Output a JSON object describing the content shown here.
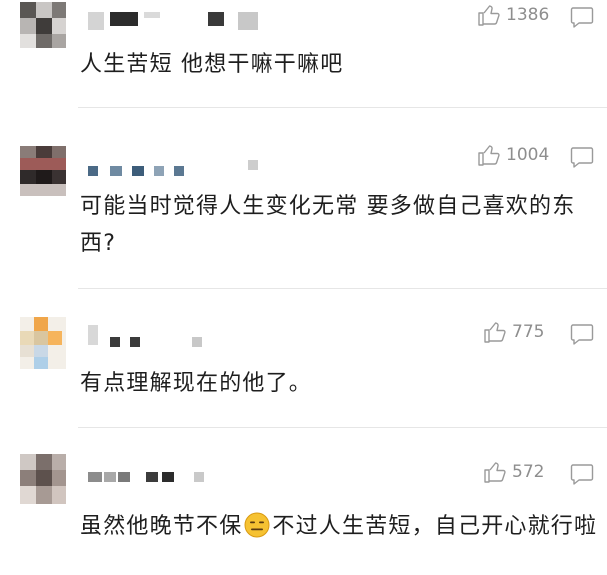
{
  "comments": [
    {
      "likes": "1386",
      "text": "人生苦短 他想干嘛干嘛吧"
    },
    {
      "likes": "1004",
      "text": "可能当时觉得人生变化无常 要多做自己喜欢的东西?"
    },
    {
      "likes": "775",
      "text": "有点理解现在的他了。"
    },
    {
      "likes": "572",
      "text_before": "虽然他晚节不保",
      "emoji": "expressionless-face-icon",
      "text_after": "不过人生苦短，自己开心就行啦"
    }
  ],
  "icons": {
    "like": "thumbs-up-icon",
    "reply": "comment-bubble-icon"
  },
  "colors": {
    "text": "#1e1e1e",
    "meta": "#8e8e8e",
    "divider": "#e6e6e6",
    "emoji": "#f6c232"
  }
}
